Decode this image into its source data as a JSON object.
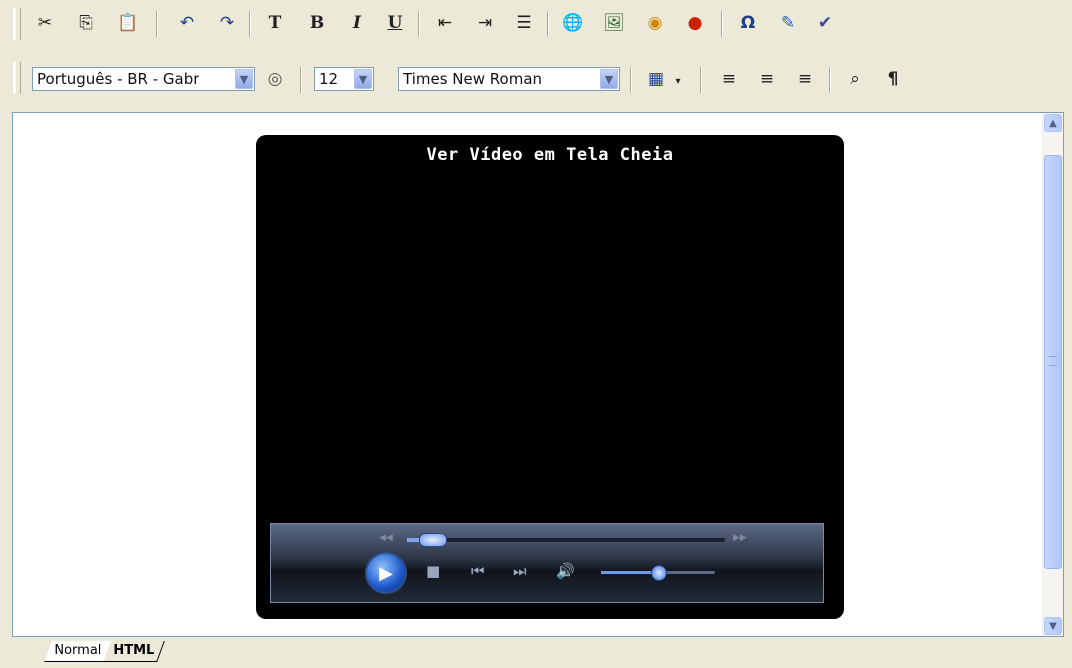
{
  "toolbar_row1": {
    "buttons": [
      {
        "name": "cut-button",
        "icon": "scissors-icon",
        "glyph": "✂"
      },
      {
        "name": "copy-button",
        "icon": "copy-icon",
        "glyph": "⎘"
      },
      {
        "name": "paste-button",
        "icon": "paste-icon",
        "glyph": "📋"
      },
      {
        "name": "undo-button",
        "icon": "undo-icon",
        "glyph": "↶"
      },
      {
        "name": "redo-button",
        "icon": "redo-icon",
        "glyph": "↷"
      },
      {
        "name": "text-color-button",
        "icon": "text-color-icon",
        "glyph": "T"
      },
      {
        "name": "bold-button",
        "icon": "bold-icon",
        "glyph": "B"
      },
      {
        "name": "italic-button",
        "icon": "italic-icon",
        "glyph": "I"
      },
      {
        "name": "underline-button",
        "icon": "underline-icon",
        "glyph": "U"
      },
      {
        "name": "outdent-button",
        "icon": "outdent-icon",
        "glyph": "⇤"
      },
      {
        "name": "indent-button",
        "icon": "indent-icon",
        "glyph": "⇥"
      },
      {
        "name": "bullet-list-button",
        "icon": "bullet-list-icon",
        "glyph": "☰"
      },
      {
        "name": "insert-link-button",
        "icon": "globe-link-icon",
        "glyph": "🌐"
      },
      {
        "name": "insert-image-button",
        "icon": "image-icon",
        "glyph": "🖼"
      },
      {
        "name": "insert-media-button",
        "icon": "media-icon",
        "glyph": "◉"
      },
      {
        "name": "insert-flash-button",
        "icon": "flash-icon",
        "glyph": "●"
      },
      {
        "name": "special-char-button",
        "icon": "omega-icon",
        "glyph": "Ω"
      },
      {
        "name": "edit-button",
        "icon": "edit-icon",
        "glyph": "✎"
      },
      {
        "name": "spellcheck-button",
        "icon": "spellcheck-icon",
        "glyph": "✔"
      }
    ]
  },
  "toolbar_row2": {
    "language_select": "Português - BR - Gabr",
    "font_size_select": "12",
    "font_family_select": "Times New Roman",
    "buttons": [
      {
        "name": "language-button",
        "icon": "audio-icon",
        "glyph": "◎"
      },
      {
        "name": "insert-table-button",
        "icon": "table-icon",
        "glyph": "▦"
      },
      {
        "name": "align-left-button",
        "icon": "align-left-icon",
        "glyph": "≡"
      },
      {
        "name": "align-center-button",
        "icon": "align-center-icon",
        "glyph": "≡"
      },
      {
        "name": "align-right-button",
        "icon": "align-right-icon",
        "glyph": "≡"
      },
      {
        "name": "find-button",
        "icon": "binoculars-icon",
        "glyph": "⌕"
      },
      {
        "name": "show-paragraph-button",
        "icon": "pilcrow-icon",
        "glyph": "¶"
      }
    ]
  },
  "player": {
    "title": "Ver Vídeo em Tela Cheia",
    "seek_progress": 0.04,
    "volume_level": 0.5
  },
  "tabs": {
    "normal": "Normal",
    "html": "HTML"
  }
}
